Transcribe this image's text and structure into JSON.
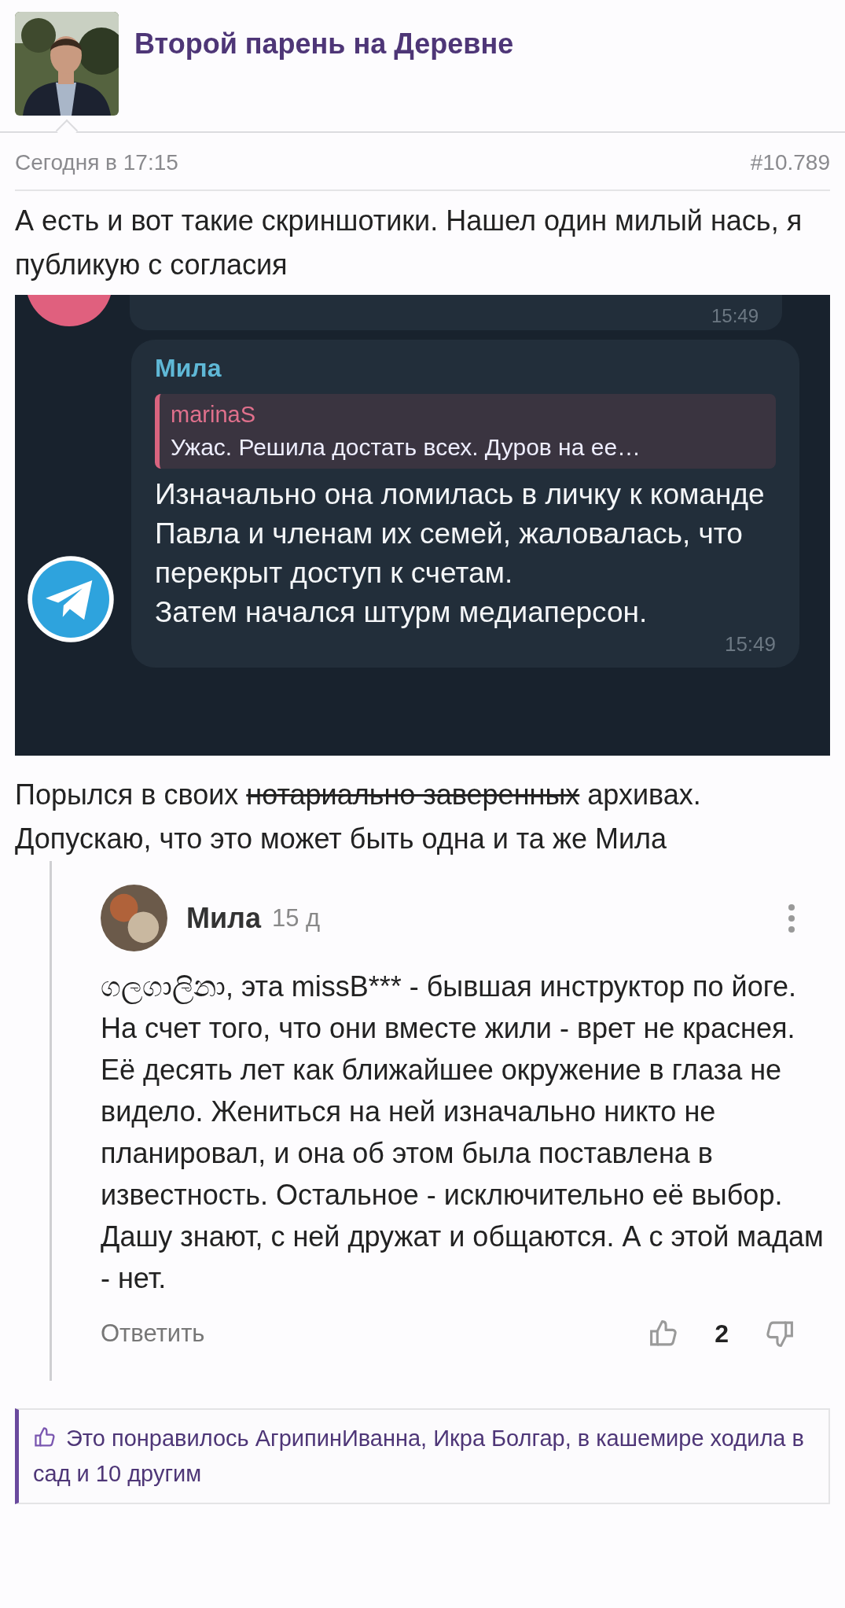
{
  "post": {
    "author": "Второй парень на Деревне",
    "date": "Сегодня в 17:15",
    "number": "#10.789",
    "text": "А есть и вот такие скриншотики. Нашел один милый нась, я публикую с согласия",
    "screenshot": {
      "top_time": "15:49",
      "sender": "Мила",
      "reply": {
        "author": "marinaS",
        "text": "Ужас. Решила достать всех. Дуров на ее…"
      },
      "text": "Изначально она ломилась в личку к команде Павла и членам их семей, жаловалась, что перекрыт доступ к счетам.\nЗатем начался штурм медиаперсон.",
      "time": "15:49"
    },
    "paragraph": [
      {
        "text": "Порылся в своих ",
        "struck": false
      },
      {
        "text": "нотариально заверенных",
        "struck": true
      },
      {
        "text": " архивах. Допускаю, что это может быть одна и та же Мила",
        "struck": false
      }
    ],
    "quote": {
      "author": "Мила",
      "age": "15 д",
      "text": "ගලගාලිනා, эта missB*** - бывшая инструктор по йоге. На счет того, что они вместе жили - врет не краснея. Её десять лет как ближайшее окружение в глаза не видело. Жениться на ней изначально никто не планировал, и она об этом была поставлена в известность. Остальное - исключительно её выбор.\nДашу знают, с ней дружат и общаются. А с этой мадам - нет.",
      "reply": "Ответить",
      "score": "2"
    },
    "likes": "Это понравилось АгрипинИванна, Икра Болгар, в кашемире ходила в сад и 10 другим"
  }
}
